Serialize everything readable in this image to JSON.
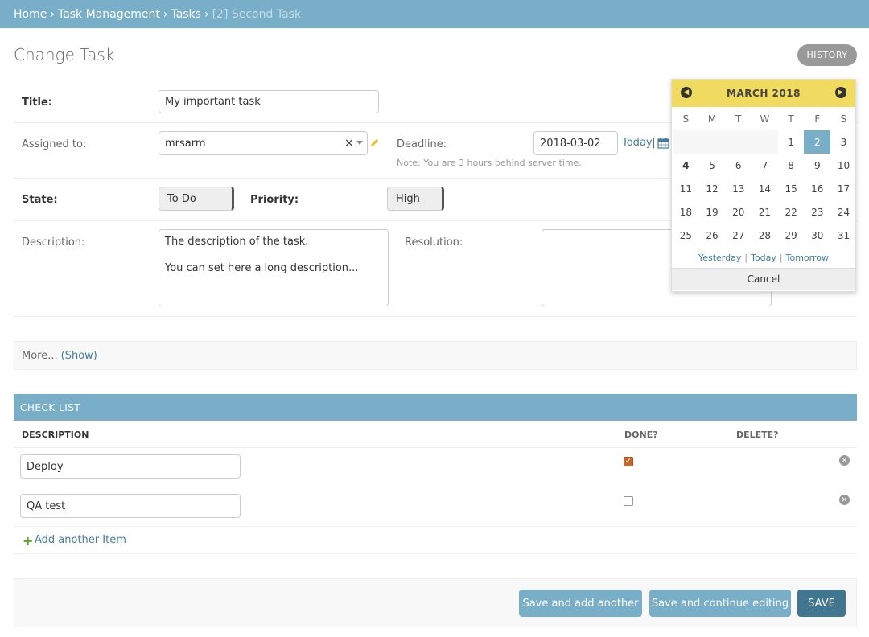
{
  "breadcrumbs": {
    "home": "Home",
    "app": "Task Management",
    "model": "Tasks",
    "current": "[2] Second Task",
    "sep": "›"
  },
  "page": {
    "title": "Change Task",
    "history_label": "HISTORY"
  },
  "form": {
    "title_label": "Title:",
    "title_value": "My important task",
    "assigned_label": "Assigned to:",
    "assigned_value": "mrsarm",
    "clear_glyph": "×",
    "deadline_label": "Deadline:",
    "deadline_value": "2018-03-02",
    "today_link": "Today",
    "link_sep": "|",
    "deadline_note": "Note: You are 3 hours behind server time.",
    "state_label": "State:",
    "state_value": "To Do",
    "priority_label": "Priority:",
    "priority_value": "High",
    "description_label": "Description:",
    "description_line1": "The description of the task.",
    "description_line2": "You can set here a long description...",
    "resolution_label": "Resolution:"
  },
  "calendar": {
    "month_label": "MARCH 2018",
    "days_of_week": [
      "S",
      "M",
      "T",
      "W",
      "T",
      "F",
      "S"
    ],
    "weeks": [
      [
        "",
        "",
        "",
        "",
        "1",
        "2",
        "3"
      ],
      [
        "4",
        "5",
        "6",
        "7",
        "8",
        "9",
        "10"
      ],
      [
        "11",
        "12",
        "13",
        "14",
        "15",
        "16",
        "17"
      ],
      [
        "18",
        "19",
        "20",
        "21",
        "22",
        "23",
        "24"
      ],
      [
        "25",
        "26",
        "27",
        "28",
        "29",
        "30",
        "31"
      ]
    ],
    "selected_day": "2",
    "today_day": "4",
    "shortcut_yesterday": "Yesterday",
    "shortcut_today": "Today",
    "shortcut_tomorrow": "Tomorrow",
    "shortcut_sep": "|",
    "cancel_label": "Cancel"
  },
  "more": {
    "label": "More...",
    "show_link": "(Show)"
  },
  "checklist": {
    "heading": "CHECK LIST",
    "col_description": "DESCRIPTION",
    "col_done": "DONE?",
    "col_delete": "DELETE?",
    "items": [
      {
        "description": "Deploy",
        "done": true
      },
      {
        "description": "QA test",
        "done": false
      }
    ],
    "add_another": "Add another Item",
    "plus_glyph": "+"
  },
  "actions": {
    "save_add_another": "Save and add another",
    "save_continue": "Save and continue editing",
    "save": "SAVE"
  },
  "colors": {
    "header_blue": "#79aec8",
    "link_blue": "#447e9b",
    "calendar_yellow": "#f0da60",
    "save_primary": "#417690"
  }
}
